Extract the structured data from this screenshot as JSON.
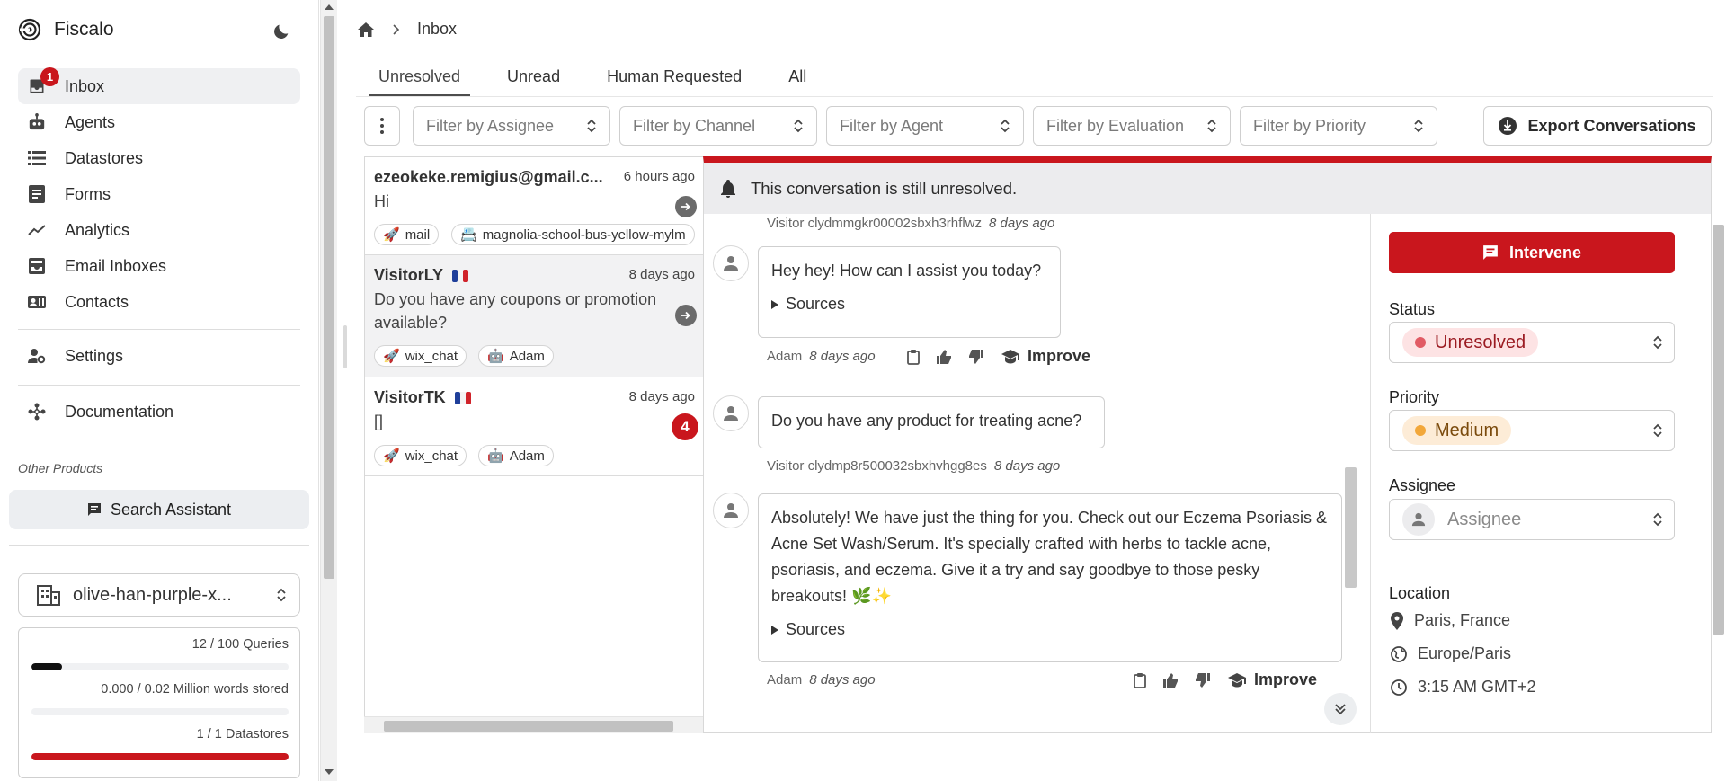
{
  "app": {
    "brand": "Fiscalo"
  },
  "sidebar": {
    "items": [
      {
        "label": "Inbox",
        "icon": "inbox-icon",
        "badge": "1",
        "active": true
      },
      {
        "label": "Agents",
        "icon": "robot-icon"
      },
      {
        "label": "Datastores",
        "icon": "list-icon"
      },
      {
        "label": "Forms",
        "icon": "form-icon"
      },
      {
        "label": "Analytics",
        "icon": "trend-icon"
      },
      {
        "label": "Email Inboxes",
        "icon": "email-inbox-icon"
      },
      {
        "label": "Contacts",
        "icon": "contacts-icon"
      }
    ],
    "settings": {
      "label": "Settings",
      "icon": "user-gear-icon"
    },
    "documentation": {
      "label": "Documentation",
      "icon": "hub-icon"
    },
    "other_products_label": "Other Products",
    "search_assistant_label": "Search Assistant",
    "org_name": "olive-han-purple-x...",
    "usage": {
      "queries": {
        "label": "12 / 100 Queries",
        "fraction": 0.12,
        "color": "#111111"
      },
      "words": {
        "label": "0.000 / 0.02 Million words stored",
        "fraction": 0.0,
        "color": "#111111"
      },
      "datastores": {
        "label": "1 / 1 Datastores",
        "fraction": 1.0,
        "color": "#c9161d"
      }
    }
  },
  "breadcrumb": {
    "current": "Inbox"
  },
  "tabs": [
    {
      "label": "Unresolved",
      "active": true
    },
    {
      "label": "Unread"
    },
    {
      "label": "Human Requested"
    },
    {
      "label": "All"
    }
  ],
  "filters": {
    "assignee": "Filter by Assignee",
    "channel": "Filter by Channel",
    "agent": "Filter by Agent",
    "evaluation": "Filter by Evaluation",
    "priority": "Filter by Priority",
    "export_label": "Export Conversations"
  },
  "conversations": [
    {
      "name": "ezeokeke.remigius@gmail.c...",
      "time": "6 hours ago",
      "message": "Hi",
      "chips": [
        "mail",
        "magnolia-school-bus-yellow-mylm"
      ]
    },
    {
      "name": "VisitorLY",
      "time": "8 days ago",
      "message": "Do you have any coupons or promotion available?",
      "chips": [
        "wix_chat",
        "Adam"
      ]
    },
    {
      "name": "VisitorTK",
      "time": "8 days ago",
      "message": "[]",
      "unread_count": "4",
      "chips": [
        "wix_chat",
        "Adam"
      ]
    }
  ],
  "banner": {
    "text": "This conversation is still unresolved."
  },
  "messages": [
    {
      "author": "Visitor clydmmgkr00002sbxh3rhflwz",
      "time": "8 days ago"
    },
    {
      "text": "Hey hey! How can I assist you today?",
      "sources_label": "Sources",
      "author": "Adam",
      "time": "8 days ago",
      "improve_label": "Improve"
    },
    {
      "text": "Do you have any product for treating acne?",
      "author": "Visitor clydmp8r500032sbxhvhgg8es",
      "time": "8 days ago"
    },
    {
      "text": "Absolutely! We have just the thing for you. Check out our Eczema Psoriasis & Acne Set Wash/Serum. It's specially crafted with herbs to tackle acne, psoriasis, and eczema. Give it a try and say goodbye to those pesky breakouts! 🌿✨",
      "sources_label": "Sources",
      "author": "Adam",
      "time": "8 days ago",
      "improve_label": "Improve"
    }
  ],
  "details": {
    "intervene_label": "Intervene",
    "status_label": "Status",
    "status_value": "Unresolved",
    "priority_label": "Priority",
    "priority_value": "Medium",
    "assignee_label": "Assignee",
    "assignee_placeholder": "Assignee",
    "location_label": "Location",
    "location_city": "Paris, France",
    "timezone": "Europe/Paris",
    "local_time": "3:15 AM GMT+2"
  },
  "colors": {
    "accent_red": "#c9161d",
    "status_pill_bg": "#fde3e4",
    "status_dot": "#e15b64",
    "priority_pill_bg": "#fdecd7",
    "priority_dot": "#f2a73a"
  }
}
